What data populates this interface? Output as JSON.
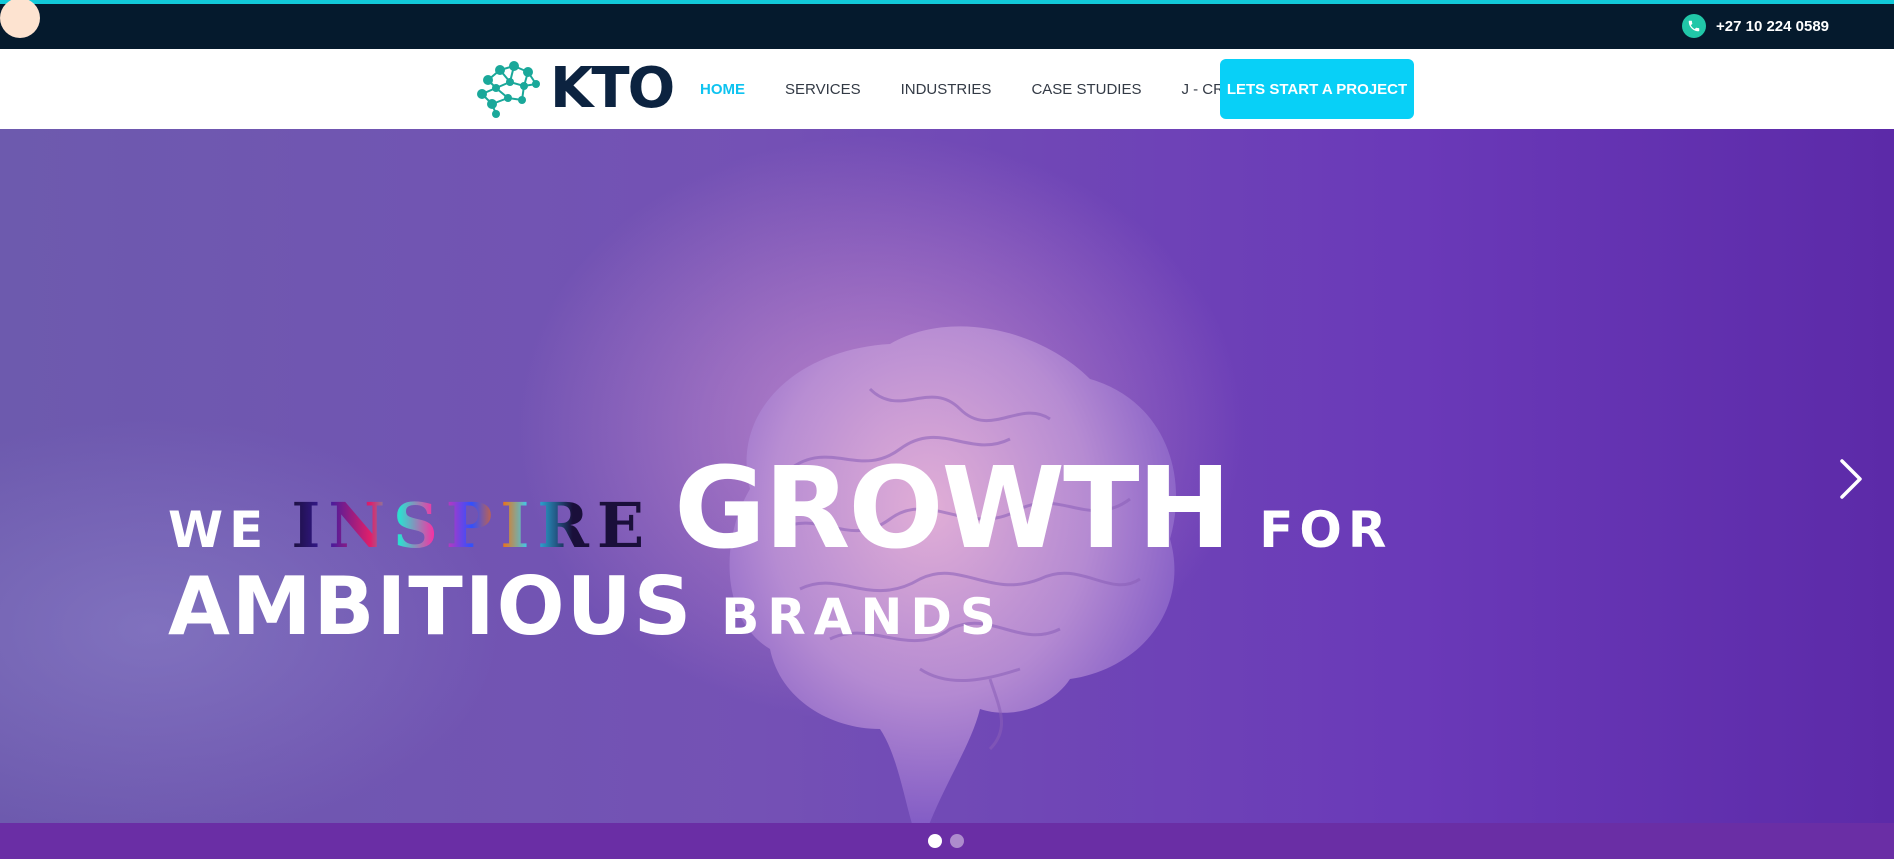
{
  "topbar": {
    "phone_icon": "phone-icon",
    "phone": "+27 10 224 0589"
  },
  "nav": {
    "logo_text": "KTO",
    "links": [
      {
        "label": "HOME",
        "active": true
      },
      {
        "label": "SERVICES",
        "active": false
      },
      {
        "label": "INDUSTRIES",
        "active": false
      },
      {
        "label": "CASE STUDIES",
        "active": false
      },
      {
        "label": "J - CRED",
        "active": false
      }
    ],
    "cta_label": "LETS START A PROJECT"
  },
  "hero": {
    "words": {
      "we": "WE",
      "inspire": "INSPIRE",
      "growth": "GROWTH",
      "for": "FOR",
      "ambitious": "AMBITIOUS",
      "brands": "BRANDS"
    },
    "next_icon": "chevron-right-icon",
    "slides": {
      "count": 2,
      "active": 1
    }
  },
  "colors": {
    "topbar_bg": "#051a2d",
    "accent": "#08d0f7",
    "active_link": "#0ec3f0",
    "logo_dark": "#0c2340",
    "logo_teal": "#1aa89a",
    "hero_purple": "#6a39b8"
  }
}
